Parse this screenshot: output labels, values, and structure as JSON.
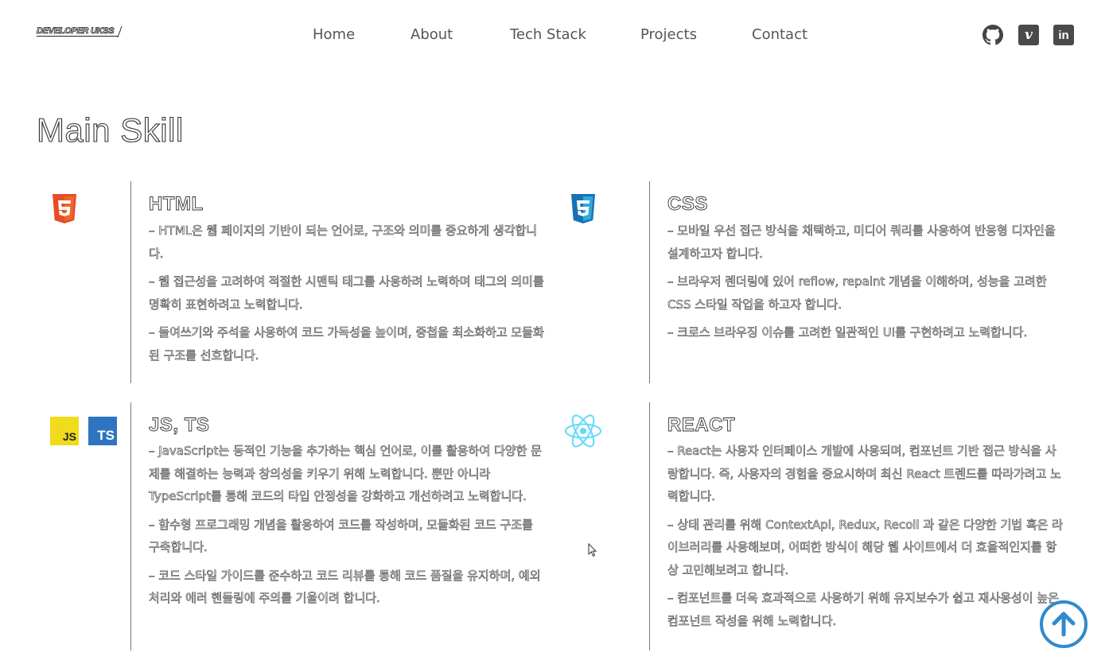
{
  "header": {
    "logo_text": "DEVELOPER UKSS",
    "nav": [
      {
        "label": "Home"
      },
      {
        "label": "About"
      },
      {
        "label": "Tech Stack"
      },
      {
        "label": "Projects"
      },
      {
        "label": "Contact"
      }
    ],
    "social": [
      {
        "icon": "github-icon"
      },
      {
        "icon": "vimeo-icon",
        "glyph": "v"
      },
      {
        "icon": "linkedin-icon",
        "glyph": "in"
      }
    ]
  },
  "main": {
    "title": "Main Skill",
    "skills": [
      {
        "title": "HTML",
        "icons": [
          "html5-icon"
        ],
        "lines": [
          "– HTML은 웹 페이지의 기반이 되는 언어로, 구조와 의미를 중요하게 생각합니다.",
          "– 웹 접근성을 고려하여 적절한 시맨틱 태그를 사용하려 노력하며 태그의 의미를 명확히 표현하려고 노력합니다.",
          "– 들여쓰기와 주석을 사용하여 코드 가독성을 높이며, 중첩을 최소화하고 모듈화된 구조를 선호합니다."
        ]
      },
      {
        "title": "CSS",
        "icons": [
          "css3-icon"
        ],
        "lines": [
          "– 모바일 우선 접근 방식을 채택하고, 미디어 쿼리를 사용하여 반응형 디자인을 설계하고자 합니다.",
          "– 브라우저 렌더링에 있어 reflow, repaint 개념을 이해하며, 성능을 고려한 CSS 스타일 작업을 하고자 합니다.",
          "– 크로스 브라우징 이슈를 고려한 일관적인 UI를 구현하려고 노력합니다."
        ]
      },
      {
        "title": "JS, TS",
        "icons": [
          "javascript-icon",
          "typescript-icon"
        ],
        "badges": {
          "js": "JS",
          "ts": "TS"
        },
        "lines": [
          "– JavaScript는 동적인 기능을 추가하는 핵심 언어로, 이를 활용하여 다양한 문제를 해결하는 능력과 창의성을 키우기 위해 노력합니다. 뿐만 아니라 TypeScript를 통해 코드의 타입 안정성을 강화하고 개선하려고 노력합니다.",
          "– 함수형 프로그래밍 개념을 활용하여 코드를 작성하며, 모듈화된 코드 구조를 구축합니다.",
          "– 코드 스타일 가이드를 준수하고 코드 리뷰를 통해 코드 품질을 유지하며, 예외 처리와 에러 핸들링에 주의를 기울이려 합니다."
        ]
      },
      {
        "title": "REACT",
        "icons": [
          "react-icon"
        ],
        "lines": [
          "– React는 사용자 인터페이스 개발에 사용되며, 컴포넌트 기반 접근 방식을 사랑합니다. 즉, 사용자의 경험을 중요시하며 최신 React 트렌드를 따라가려고 노력합니다.",
          "– 상태 관리를 위해 ContextApi, Redux, Recoil 과 같은 다양한 기법 혹은 라이브러리를 사용해보며, 어떠한 방식이 해당 웹 사이트에서 더 효율적인지를 항상 고민해보려고 합니다.",
          "– 컴포넌트를 더욱 효과적으로 사용하기 위해 유지보수가 쉽고 재사용성이 높은 컴포넌트 작성을 위해 노력합니다."
        ]
      }
    ]
  },
  "colors": {
    "accent": "#2f8ad0",
    "html5": "#e44d26",
    "css3": "#1572b6",
    "js": "#f0db1c",
    "ts": "#2f74c0",
    "react": "#61dafb"
  },
  "scroll_top": {
    "icon": "arrow-up-icon"
  }
}
